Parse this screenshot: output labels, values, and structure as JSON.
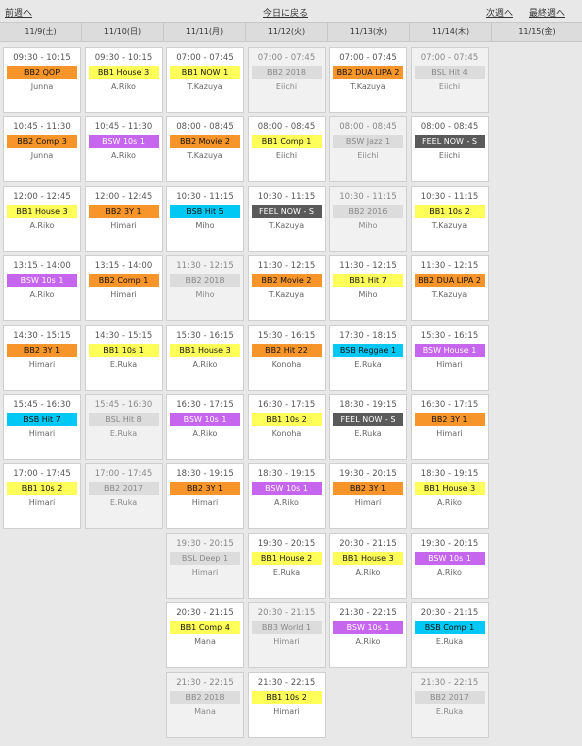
{
  "nav": {
    "prev_label": "前週へ",
    "today_label": "今日に戻る",
    "next_label": "次週へ",
    "last_label": "最終週へ"
  },
  "days": [
    "11/9(土)",
    "11/10(日)",
    "11/11(月)",
    "11/12(火)",
    "11/13(水)",
    "11/14(木)",
    "11/15(金)"
  ],
  "colors": {
    "orange": "#f7942a",
    "yellow": "#ffff5a",
    "purple": "#c665ee",
    "cyan": "#00c8f5",
    "dark": "#5a5a5a",
    "gray": "#dcdcdc"
  },
  "schedule": [
    [
      {
        "time": "09:30 - 10:15",
        "program": "BB2 QOP",
        "instructor": "Junna",
        "color": "orange",
        "past": false
      },
      {
        "time": "10:45 - 11:30",
        "program": "BB2 Comp 3",
        "instructor": "Junna",
        "color": "orange",
        "past": false
      },
      {
        "time": "12:00 - 12:45",
        "program": "BB1 House 3",
        "instructor": "A.Riko",
        "color": "yellow",
        "past": false
      },
      {
        "time": "13:15 - 14:00",
        "program": "BSW 10s 1",
        "instructor": "A.Riko",
        "color": "purple",
        "past": false
      },
      {
        "time": "14:30 - 15:15",
        "program": "BB2 3Y 1",
        "instructor": "Himari",
        "color": "orange",
        "past": false
      },
      {
        "time": "15:45 - 16:30",
        "program": "BSB Hit 7",
        "instructor": "Himari",
        "color": "cyan",
        "past": false
      },
      {
        "time": "17:00 - 17:45",
        "program": "BB1 10s 2",
        "instructor": "Himari",
        "color": "yellow",
        "past": false
      }
    ],
    [
      {
        "time": "09:30 - 10:15",
        "program": "BB1 House 3",
        "instructor": "A.Riko",
        "color": "yellow",
        "past": false
      },
      {
        "time": "10:45 - 11:30",
        "program": "BSW 10s 1",
        "instructor": "A.Riko",
        "color": "purple",
        "past": false
      },
      {
        "time": "12:00 - 12:45",
        "program": "BB2 3Y 1",
        "instructor": "Himari",
        "color": "orange",
        "past": false
      },
      {
        "time": "13:15 - 14:00",
        "program": "BB2 Comp 1",
        "instructor": "Himari",
        "color": "orange",
        "past": false
      },
      {
        "time": "14:30 - 15:15",
        "program": "BB1 10s 1",
        "instructor": "E.Ruka",
        "color": "yellow",
        "past": false
      },
      {
        "time": "15:45 - 16:30",
        "program": "BSL Hit 8",
        "instructor": "E.Ruka",
        "color": "gray",
        "past": true
      },
      {
        "time": "17:00 - 17:45",
        "program": "BB2 2017",
        "instructor": "E.Ruka",
        "color": "gray",
        "past": true
      }
    ],
    [
      {
        "time": "07:00 - 07:45",
        "program": "BB1 NOW 1",
        "instructor": "T.Kazuya",
        "color": "yellow",
        "past": false
      },
      {
        "time": "08:00 - 08:45",
        "program": "BB2 Movie 2",
        "instructor": "T.Kazuya",
        "color": "orange",
        "past": false
      },
      {
        "time": "10:30 - 11:15",
        "program": "BSB Hit 5",
        "instructor": "Miho",
        "color": "cyan",
        "past": false
      },
      {
        "time": "11:30 - 12:15",
        "program": "BB2 2018",
        "instructor": "Miho",
        "color": "gray",
        "past": true
      },
      {
        "time": "15:30 - 16:15",
        "program": "BB1 House 3",
        "instructor": "A.Riko",
        "color": "yellow",
        "past": false
      },
      {
        "time": "16:30 - 17:15",
        "program": "BSW 10s 1",
        "instructor": "A.Riko",
        "color": "purple",
        "past": false
      },
      {
        "time": "18:30 - 19:15",
        "program": "BB2 3Y 1",
        "instructor": "Himari",
        "color": "orange",
        "past": false
      },
      {
        "time": "19:30 - 20:15",
        "program": "BSL Deep 1",
        "instructor": "Himari",
        "color": "gray",
        "past": true
      },
      {
        "time": "20:30 - 21:15",
        "program": "BB1 Comp 4",
        "instructor": "Mana",
        "color": "yellow",
        "past": false
      },
      {
        "time": "21:30 - 22:15",
        "program": "BB2 2018",
        "instructor": "Mana",
        "color": "gray",
        "past": true
      }
    ],
    [
      {
        "time": "07:00 - 07:45",
        "program": "BB2 2018",
        "instructor": "Eiichi",
        "color": "gray",
        "past": true
      },
      {
        "time": "08:00 - 08:45",
        "program": "BB1 Comp 1",
        "instructor": "Eiichi",
        "color": "yellow",
        "past": false
      },
      {
        "time": "10:30 - 11:15",
        "program": "FEEL NOW - S",
        "instructor": "T.Kazuya",
        "color": "dark",
        "past": false
      },
      {
        "time": "11:30 - 12:15",
        "program": "BB2 Movie 2",
        "instructor": "T.Kazuya",
        "color": "orange",
        "past": false
      },
      {
        "time": "15:30 - 16:15",
        "program": "BB2 Hit 22",
        "instructor": "Konoha",
        "color": "orange",
        "past": false
      },
      {
        "time": "16:30 - 17:15",
        "program": "BB1 10s 2",
        "instructor": "Konoha",
        "color": "yellow",
        "past": false
      },
      {
        "time": "18:30 - 19:15",
        "program": "BSW 10s 1",
        "instructor": "A.Riko",
        "color": "purple",
        "past": false
      },
      {
        "time": "19:30 - 20:15",
        "program": "BB1 House 2",
        "instructor": "E.Ruka",
        "color": "yellow",
        "past": false
      },
      {
        "time": "20:30 - 21:15",
        "program": "BB3 World 1",
        "instructor": "Himari",
        "color": "gray",
        "past": true
      },
      {
        "time": "21:30 - 22:15",
        "program": "BB1 10s 2",
        "instructor": "Himari",
        "color": "yellow",
        "past": false
      }
    ],
    [
      {
        "time": "07:00 - 07:45",
        "program": "BB2 DUA LIPA 2",
        "instructor": "T.Kazuya",
        "color": "orange",
        "past": false
      },
      {
        "time": "08:00 - 08:45",
        "program": "BSW Jazz 1",
        "instructor": "Eiichi",
        "color": "gray",
        "past": true
      },
      {
        "time": "10:30 - 11:15",
        "program": "BB2 2016",
        "instructor": "Miho",
        "color": "gray",
        "past": true
      },
      {
        "time": "11:30 - 12:15",
        "program": "BB1 Hit 7",
        "instructor": "Miho",
        "color": "yellow",
        "past": false
      },
      {
        "time": "17:30 - 18:15",
        "program": "BSB Reggae 1",
        "instructor": "E.Ruka",
        "color": "cyan",
        "past": false
      },
      {
        "time": "18:30 - 19:15",
        "program": "FEEL NOW - S",
        "instructor": "E.Ruka",
        "color": "dark",
        "past": false
      },
      {
        "time": "19:30 - 20:15",
        "program": "BB2 3Y 1",
        "instructor": "Himari",
        "color": "orange",
        "past": false
      },
      {
        "time": "20:30 - 21:15",
        "program": "BB1 House 3",
        "instructor": "A.Riko",
        "color": "yellow",
        "past": false
      },
      {
        "time": "21:30 - 22:15",
        "program": "BSW 10s 1",
        "instructor": "A.Riko",
        "color": "purple",
        "past": false
      }
    ],
    [
      {
        "time": "07:00 - 07:45",
        "program": "BSL Hit 4",
        "instructor": "Eiichi",
        "color": "gray",
        "past": true
      },
      {
        "time": "08:00 - 08:45",
        "program": "FEEL NOW - S",
        "instructor": "Eiichi",
        "color": "dark",
        "past": false
      },
      {
        "time": "10:30 - 11:15",
        "program": "BB1 10s 2",
        "instructor": "T.Kazuya",
        "color": "yellow",
        "past": false
      },
      {
        "time": "11:30 - 12:15",
        "program": "BB2 DUA LIPA 2",
        "instructor": "T.Kazuya",
        "color": "orange",
        "past": false
      },
      {
        "time": "15:30 - 16:15",
        "program": "BSW House 1",
        "instructor": "Himari",
        "color": "purple",
        "past": false
      },
      {
        "time": "16:30 - 17:15",
        "program": "BB2 3Y 1",
        "instructor": "Himari",
        "color": "orange",
        "past": false
      },
      {
        "time": "18:30 - 19:15",
        "program": "BB1 House 3",
        "instructor": "A.Riko",
        "color": "yellow",
        "past": false
      },
      {
        "time": "19:30 - 20:15",
        "program": "BSW 10s 1",
        "instructor": "A.Riko",
        "color": "purple",
        "past": false
      },
      {
        "time": "20:30 - 21:15",
        "program": "BSB Comp 1",
        "instructor": "E.Ruka",
        "color": "cyan",
        "past": false
      },
      {
        "time": "21:30 - 22:15",
        "program": "BB2 2017",
        "instructor": "E.Ruka",
        "color": "gray",
        "past": true
      }
    ],
    []
  ]
}
